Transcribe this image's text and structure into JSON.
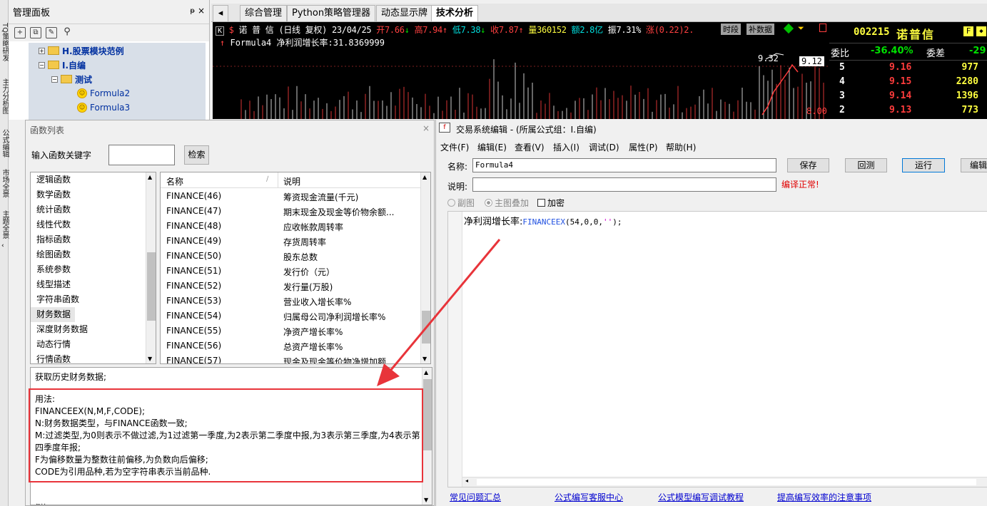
{
  "left_strip": {
    "tabs": [
      "TQ策略研发",
      "主力分析图",
      "公式编辑",
      "市场全景",
      "主题全景"
    ]
  },
  "manage_panel": {
    "title": "管理面板",
    "pin": "ᵽ",
    "close": "×",
    "tree": [
      {
        "label": "H.股票模块范例",
        "level": 1,
        "type": "folder"
      },
      {
        "label": "I.自编",
        "level": 1,
        "type": "folder"
      },
      {
        "label": "测试",
        "level": 2,
        "type": "folder"
      },
      {
        "label": "Formula2",
        "level": 3,
        "type": "formula"
      },
      {
        "label": "Formula3",
        "level": 3,
        "type": "formula"
      }
    ]
  },
  "main_tabs": [
    "综合管理",
    "Python策略管理器",
    "动态显示牌",
    "技术分析"
  ],
  "main_tabs_active": 3,
  "chart": {
    "header_k": "K",
    "header_s": "$",
    "stock_name": "诺 普 信",
    "period": "(日线 复权)",
    "date": "23/04/25",
    "open_label": "开",
    "open": "7.66",
    "open_arrow": "↓",
    "high_label": "高",
    "high": "7.94",
    "high_arrow": "↑",
    "low_label": "低",
    "low": "7.38",
    "low_arrow": "↓",
    "close_label": "收",
    "close": "7.87",
    "close_arrow": "↑",
    "vol_label": "量",
    "vol": "360152",
    "amt_label": "额",
    "amt": "2.8亿",
    "amp_label": "振",
    "amp": "7.31%",
    "chg_label": "涨",
    "chg": "(0.22)2.",
    "btn_time": "时段",
    "btn_supp": "补数据",
    "formula_line": "Formula4  净利润增长率:31.8369999",
    "price_932": "9.32",
    "price_912": "9.12",
    "price_800": "8.00"
  },
  "quote": {
    "code": "002215",
    "name": "诺普信",
    "btn1": "F",
    "btn2": "◆",
    "wb_label": "委比",
    "wb_value": "-36.40%",
    "wc_label": "委差",
    "wc_value": "-29",
    "rows": [
      {
        "level": "5",
        "price": "9.16",
        "vol": "977"
      },
      {
        "level": "4",
        "price": "9.15",
        "vol": "2280"
      },
      {
        "level": "3",
        "price": "9.14",
        "vol": "1396"
      },
      {
        "level": "2",
        "price": "9.13",
        "vol": "773"
      }
    ]
  },
  "func_dialog": {
    "title": "函数列表",
    "close": "×",
    "search_label": "输入函数关键字",
    "search_value": "",
    "search_btn": "检索",
    "categories": [
      "逻辑函数",
      "数学函数",
      "统计函数",
      "线性代数",
      "指标函数",
      "绘图函数",
      "系统参数",
      "线型描述",
      "字符串函数",
      "财务数据",
      "深度财务数据",
      "动态行情",
      "行情函数"
    ],
    "selected_category": 9,
    "col_name": "名称",
    "col_desc": "说明",
    "functions": [
      {
        "name": "FINANCE(46)",
        "desc": "筹资现金流量(千元)"
      },
      {
        "name": "FINANCE(47)",
        "desc": "期末现金及现金等价物余额..."
      },
      {
        "name": "FINANCE(48)",
        "desc": "应收帐款周转率"
      },
      {
        "name": "FINANCE(49)",
        "desc": "存货周转率"
      },
      {
        "name": "FINANCE(50)",
        "desc": "股东总数"
      },
      {
        "name": "FINANCE(51)",
        "desc": "发行价（元）"
      },
      {
        "name": "FINANCE(52)",
        "desc": "发行量(万股)"
      },
      {
        "name": "FINANCE(53)",
        "desc": "营业收入增长率%"
      },
      {
        "name": "FINANCE(54)",
        "desc": "归属母公司净利润增长率%"
      },
      {
        "name": "FINANCE(55)",
        "desc": "净资产增长率%"
      },
      {
        "name": "FINANCE(56)",
        "desc": "总资产增长率%"
      },
      {
        "name": "FINANCE(57)",
        "desc": "现金及现金等价物净增加额"
      }
    ],
    "help_summary": "获取历史财务数据;",
    "help_lines": [
      "用法:",
      "FINANCEEX(N,M,F,CODE);",
      "N:财务数据类型，与FINANCE函数一致;",
      "M:过滤类型,为0则表示不做过滤,为1过滤第一季度,为2表示第二季度中报,为3表示第三季度,为4表示第",
      "四季度年报;",
      "F为偏移数量为整数往前偏移,为负数向后偏移;",
      "CODE为引用品种,若为空字符串表示当前品种."
    ],
    "help_tail": "例如"
  },
  "edit_dialog": {
    "title": "交易系统编辑 - (所属公式组：I.自编)",
    "menu": [
      "文件(F)",
      "编辑(E)",
      "查看(V)",
      "插入(I)",
      "调试(D)",
      "属性(P)",
      "帮助(H)"
    ],
    "name_label": "名称:",
    "name_value": "Formula4",
    "desc_label": "说明:",
    "desc_value": "",
    "btn_save": "保存",
    "btn_back": "回测",
    "btn_run": "运行",
    "btn_edit": "编辑",
    "compile_status": "编译正常!",
    "opt_sub": "副图",
    "opt_main": "主图叠加",
    "opt_encrypt": "加密",
    "code_label": "净利润增长率:",
    "code_func": "FINANCEEX",
    "code_args": "(54,0,0,",
    "code_str": "''",
    "code_end": ");",
    "links": [
      "常见问题汇总",
      "公式编写客服中心",
      "公式模型编写调试教程",
      "提高编写效率的注意事项"
    ]
  },
  "colors": {
    "up": "#ff3c3c",
    "down": "#00e000",
    "annotation": "#e8343a",
    "link": "#0000d0",
    "status": "#e00000"
  }
}
